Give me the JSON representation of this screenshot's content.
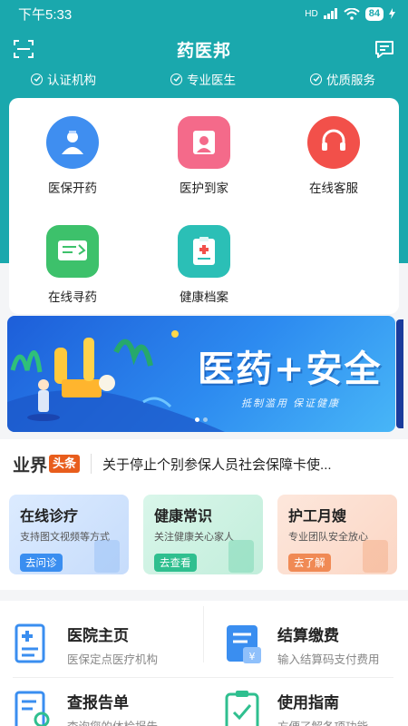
{
  "status_bar": {
    "time": "下午5:33",
    "signal": "HD",
    "battery": "84"
  },
  "header": {
    "title": "药医邦"
  },
  "trust": [
    {
      "label": "认证机构"
    },
    {
      "label": "专业医生"
    },
    {
      "label": "优质服务"
    }
  ],
  "menu": [
    {
      "label": "医保开药",
      "color": "#3f8ef0"
    },
    {
      "label": "医护到家",
      "color": "#f46a8a"
    },
    {
      "label": "在线客服",
      "color": "#f2504a"
    },
    {
      "label": "在线寻药",
      "color": "#3dc16b"
    },
    {
      "label": "健康档案",
      "color": "#2bbfb6"
    }
  ],
  "banner": {
    "title": "医药+安全",
    "subtitle": "抵制滥用  保证健康",
    "slides": 2,
    "active_slide": 1
  },
  "news": {
    "logo_text": "业界",
    "logo_badge": "头条",
    "headline": "关于停止个别参保人员社会保障卡使..."
  },
  "services": [
    {
      "title": "在线诊疗",
      "desc": "支持图文视频等方式",
      "button": "去问诊",
      "accent": "#3a8ef0"
    },
    {
      "title": "健康常识",
      "desc": "关注健康关心家人",
      "button": "去查看",
      "accent": "#2fbf8f"
    },
    {
      "title": "护工月嫂",
      "desc": "专业团队安全放心",
      "button": "去了解",
      "accent": "#f08a55"
    }
  ],
  "grid": [
    {
      "title": "医院主页",
      "desc": "医保定点医疗机构"
    },
    {
      "title": "结算缴费",
      "desc": "输入结算码支付费用"
    },
    {
      "title": "查报告单",
      "desc": "查询您的体检报告"
    },
    {
      "title": "使用指南",
      "desc": "方便了解各项功能"
    }
  ],
  "colors": {
    "primary": "#1aa8ad",
    "accent_blue": "#3a8ef0"
  }
}
